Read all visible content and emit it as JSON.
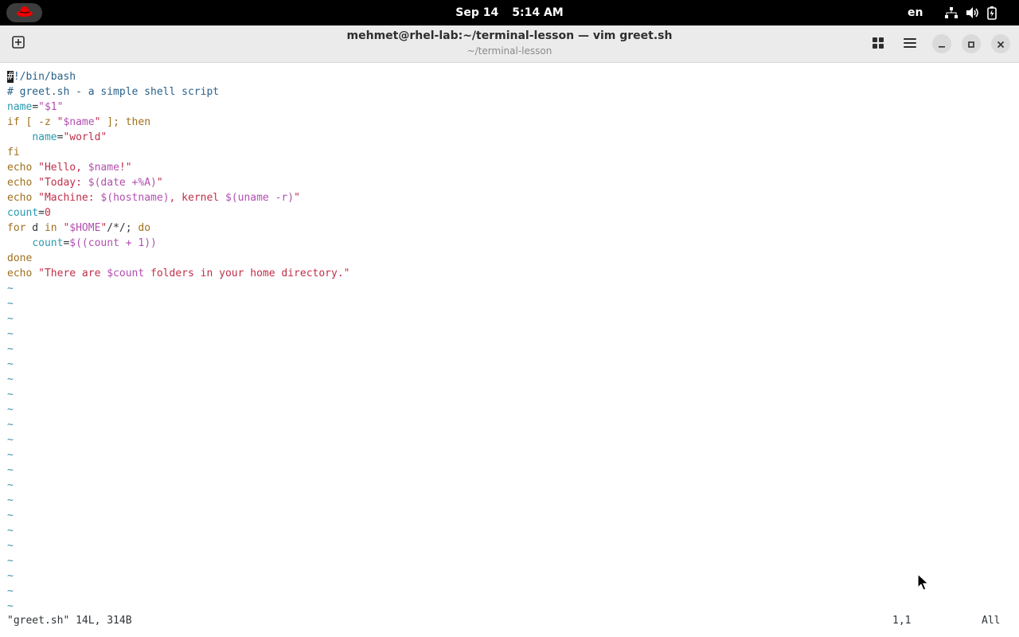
{
  "topbar": {
    "activities_icon": "redhat-logo-icon",
    "date": "Sep 14",
    "time": "5:14 AM",
    "language": "en",
    "icons": [
      "network-icon",
      "volume-icon",
      "battery-icon"
    ]
  },
  "window": {
    "title": "mehmet@rhel-lab:~/terminal-lesson — vim greet.sh",
    "subtitle": "~/terminal-lesson",
    "buttons": [
      "new-tab-icon",
      "view-grid-icon",
      "hamburger-menu-icon",
      "minimize-icon",
      "maximize-icon",
      "close-icon"
    ]
  },
  "editor": {
    "lines": [
      [
        {
          "t": "#",
          "c": "cursor"
        },
        {
          "t": "!/bin/bash",
          "c": "c-comment"
        }
      ],
      [
        {
          "t": "# greet.sh - a simple shell script",
          "c": "c-comment"
        }
      ],
      [
        {
          "t": "name",
          "c": "c-var"
        },
        {
          "t": "=",
          "c": "c-plain"
        },
        {
          "t": "\"$1\"",
          "c": "c-dollar"
        }
      ],
      [
        {
          "t": "if",
          "c": "c-key"
        },
        {
          "t": " [ -z ",
          "c": "c-key"
        },
        {
          "t": "\"",
          "c": "c-str"
        },
        {
          "t": "$name",
          "c": "c-dollar"
        },
        {
          "t": "\"",
          "c": "c-str"
        },
        {
          "t": " ]; then",
          "c": "c-key"
        }
      ],
      [
        {
          "t": "    ",
          "c": "c-plain"
        },
        {
          "t": "name",
          "c": "c-var"
        },
        {
          "t": "=",
          "c": "c-plain"
        },
        {
          "t": "\"world\"",
          "c": "c-str"
        }
      ],
      [
        {
          "t": "fi",
          "c": "c-key"
        }
      ],
      [
        {
          "t": "echo",
          "c": "c-cmd"
        },
        {
          "t": " ",
          "c": "c-plain"
        },
        {
          "t": "\"Hello, ",
          "c": "c-str"
        },
        {
          "t": "$name",
          "c": "c-dollar"
        },
        {
          "t": "!\"",
          "c": "c-str"
        }
      ],
      [
        {
          "t": "echo",
          "c": "c-cmd"
        },
        {
          "t": " ",
          "c": "c-plain"
        },
        {
          "t": "\"Today: ",
          "c": "c-str"
        },
        {
          "t": "$(date +%A)",
          "c": "c-dollar"
        },
        {
          "t": "\"",
          "c": "c-str"
        }
      ],
      [
        {
          "t": "echo",
          "c": "c-cmd"
        },
        {
          "t": " ",
          "c": "c-plain"
        },
        {
          "t": "\"Machine: ",
          "c": "c-str"
        },
        {
          "t": "$(hostname)",
          "c": "c-dollar"
        },
        {
          "t": ", kernel ",
          "c": "c-str"
        },
        {
          "t": "$(uname -r)",
          "c": "c-dollar"
        },
        {
          "t": "\"",
          "c": "c-str"
        }
      ],
      [
        {
          "t": "count",
          "c": "c-var"
        },
        {
          "t": "=",
          "c": "c-plain"
        },
        {
          "t": "0",
          "c": "c-num"
        }
      ],
      [
        {
          "t": "for",
          "c": "c-key"
        },
        {
          "t": " d ",
          "c": "c-plain"
        },
        {
          "t": "in",
          "c": "c-key"
        },
        {
          "t": " ",
          "c": "c-plain"
        },
        {
          "t": "\"",
          "c": "c-str"
        },
        {
          "t": "$HOME",
          "c": "c-dollar"
        },
        {
          "t": "\"",
          "c": "c-str"
        },
        {
          "t": "/*/; ",
          "c": "c-plain"
        },
        {
          "t": "do",
          "c": "c-key"
        }
      ],
      [
        {
          "t": "    ",
          "c": "c-plain"
        },
        {
          "t": "count",
          "c": "c-var"
        },
        {
          "t": "=",
          "c": "c-plain"
        },
        {
          "t": "$((count + 1))",
          "c": "c-dollar"
        }
      ],
      [
        {
          "t": "done",
          "c": "c-key"
        }
      ],
      [
        {
          "t": "echo",
          "c": "c-cmd"
        },
        {
          "t": " ",
          "c": "c-plain"
        },
        {
          "t": "\"There are ",
          "c": "c-str"
        },
        {
          "t": "$count",
          "c": "c-dollar"
        },
        {
          "t": " folders in your home directory.\"",
          "c": "c-str"
        }
      ]
    ],
    "empty_line_marker": "~",
    "empty_line_count": 22
  },
  "statusline": {
    "file_info": "\"greet.sh\" 14L, 314B",
    "position": "1,1",
    "scroll": "All"
  }
}
